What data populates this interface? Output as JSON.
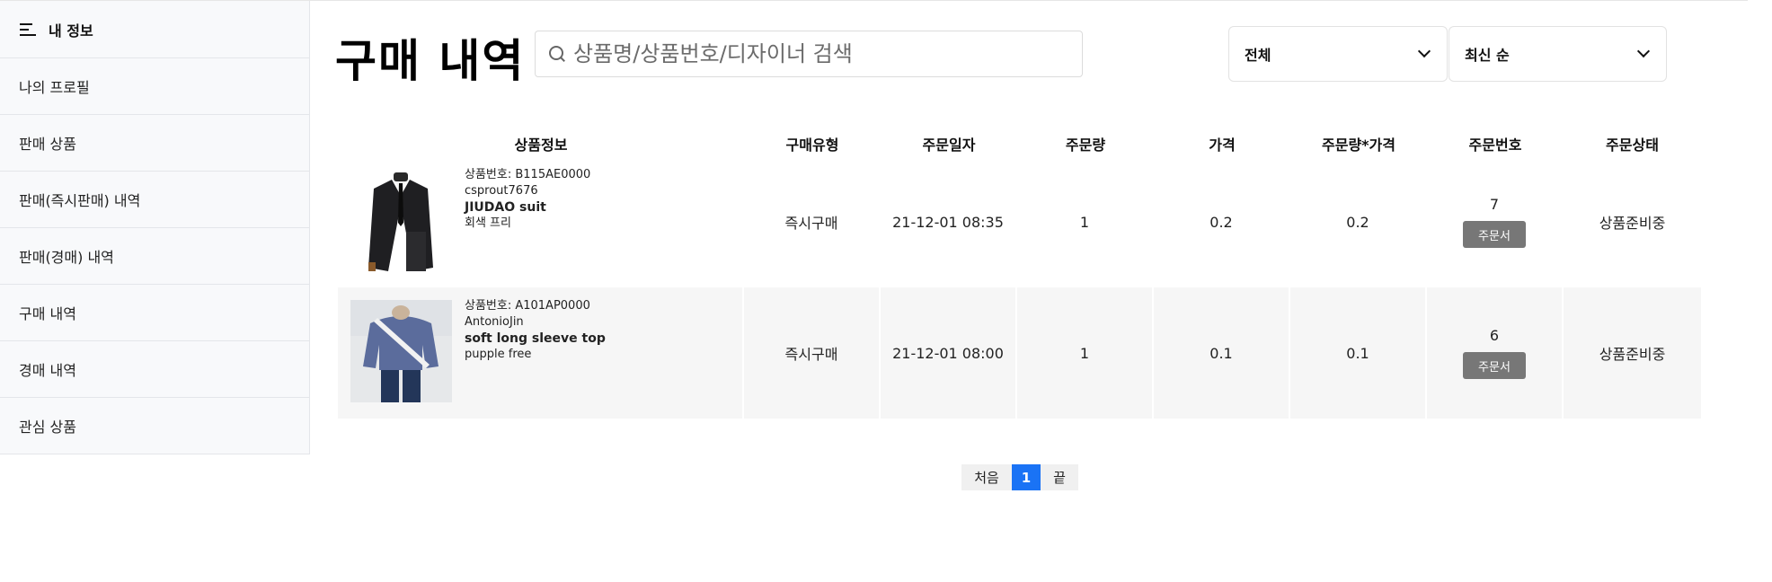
{
  "sidebar": {
    "title": "내 정보",
    "items": [
      {
        "label": "나의 프로필"
      },
      {
        "label": "판매 상품"
      },
      {
        "label": "판매(즉시판매) 내역"
      },
      {
        "label": "판매(경매) 내역"
      },
      {
        "label": "구매 내역"
      },
      {
        "label": "경매 내역"
      },
      {
        "label": "관심 상품"
      }
    ]
  },
  "header": {
    "title": "구매 내역",
    "search_placeholder": "상품명/상품번호/디자이너 검색",
    "filter_select": "전체",
    "sort_select": "최신 순"
  },
  "table": {
    "columns": [
      "상품정보",
      "구매유형",
      "주문일자",
      "주문량",
      "가격",
      "주문량*가격",
      "주문번호",
      "주문상태"
    ],
    "rows": [
      {
        "product_no": "상품번호: B115AE0000",
        "seller": "csprout7676",
        "name": "JIUDAO suit",
        "option": "회색 프리",
        "type": "즉시구매",
        "date": "21-12-01 08:35",
        "qty": "1",
        "price": "0.2",
        "total": "0.2",
        "order_no": "7",
        "order_btn": "주문서",
        "status": "상품준비중"
      },
      {
        "product_no": "상품번호: A101AP0000",
        "seller": "AntonioJin",
        "name": "soft long sleeve top",
        "option": "pupple free",
        "type": "즉시구매",
        "date": "21-12-01 08:00",
        "qty": "1",
        "price": "0.1",
        "total": "0.1",
        "order_no": "6",
        "order_btn": "주문서",
        "status": "상품준비중"
      }
    ]
  },
  "pagination": {
    "first": "처음",
    "current": "1",
    "last": "끝"
  },
  "colors": {
    "accent": "#1a73f5",
    "order_button": "#777777",
    "alt_row": "#f6f6f6"
  }
}
